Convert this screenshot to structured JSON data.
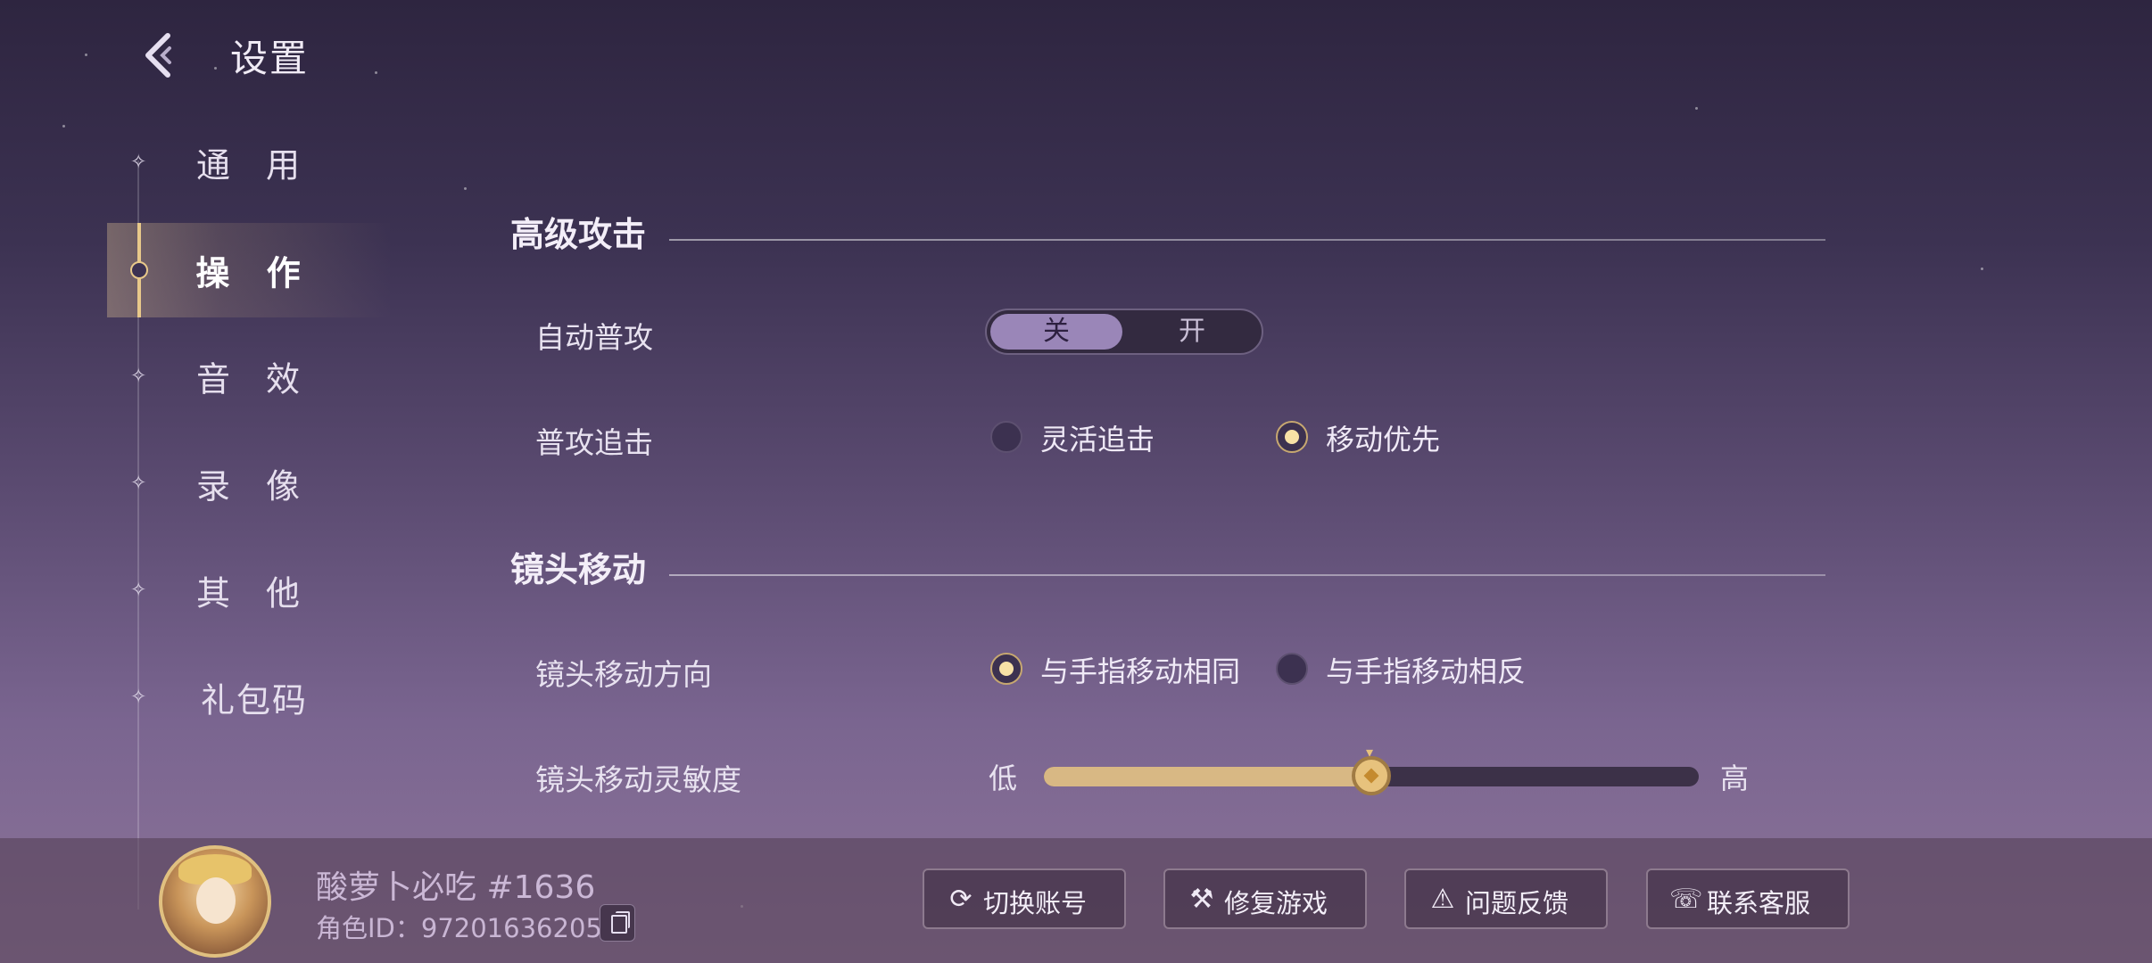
{
  "header": {
    "title": "设置"
  },
  "sidebar": {
    "items": [
      {
        "label": "通 用"
      },
      {
        "label": "操 作"
      },
      {
        "label": "音 效"
      },
      {
        "label": "录 像"
      },
      {
        "label": "其 他"
      },
      {
        "label": "礼包码"
      }
    ],
    "active_index": 1
  },
  "sections": {
    "advanced_attack": {
      "title": "高级攻击",
      "auto_attack": {
        "label": "自动普攻",
        "off_label": "关",
        "on_label": "开",
        "value": "关"
      },
      "attack_chase": {
        "label": "普攻追击",
        "options": [
          "灵活追击",
          "移动优先"
        ],
        "selected": "移动优先"
      }
    },
    "camera": {
      "title": "镜头移动",
      "direction": {
        "label": "镜头移动方向",
        "options": [
          "与手指移动相同",
          "与手指移动相反"
        ],
        "selected": "与手指移动相同"
      },
      "sensitivity": {
        "label": "镜头移动灵敏度",
        "low_label": "低",
        "high_label": "高",
        "value_fraction": 0.5
      }
    }
  },
  "footer": {
    "player_name": "酸萝卜必吃 #1636",
    "role_id": "角色ID：97201636205",
    "buttons": [
      {
        "label": "切换账号",
        "icon": "refresh-icon"
      },
      {
        "label": "修复游戏",
        "icon": "tools-icon"
      },
      {
        "label": "问题反馈",
        "icon": "warning-icon"
      },
      {
        "label": "联系客服",
        "icon": "headset-icon"
      }
    ]
  },
  "colors": {
    "accent_gold": "#e8c98a",
    "toggle_selected": "#9a86b8"
  }
}
